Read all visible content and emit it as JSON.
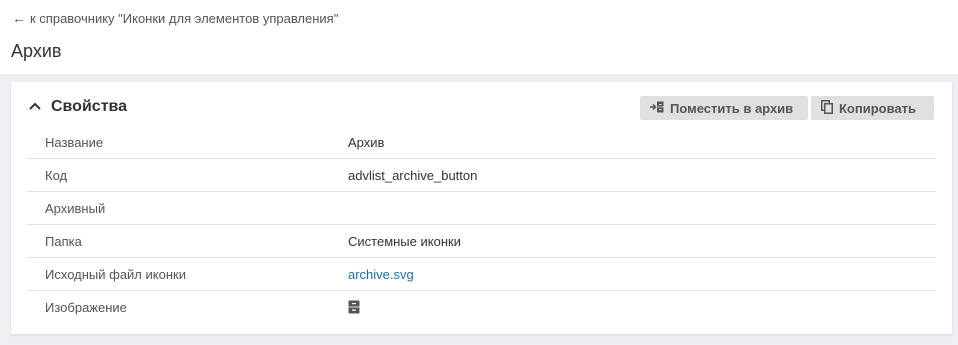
{
  "nav": {
    "back_arrow": "←",
    "back_label": "к справочнику \"Иконки для элементов управления\""
  },
  "page": {
    "title": "Архив"
  },
  "section": {
    "title": "Свойства",
    "buttons": {
      "archive_label": "Поместить в архив",
      "copy_label": "Копировать"
    }
  },
  "properties": [
    {
      "label": "Название",
      "value": "Архив"
    },
    {
      "label": "Код",
      "value": "advlist_archive_button"
    },
    {
      "label": "Архивный",
      "value": ""
    },
    {
      "label": "Папка",
      "value": "Системные иконки"
    },
    {
      "label": "Исходный файл иконки",
      "value": "archive.svg"
    },
    {
      "label": "Изображение",
      "value_icon": "archive-icon"
    }
  ],
  "colors": {
    "link": "#1f6fb2",
    "background_gray": "#eef0f4",
    "button_gray": "#e0e0e0"
  }
}
